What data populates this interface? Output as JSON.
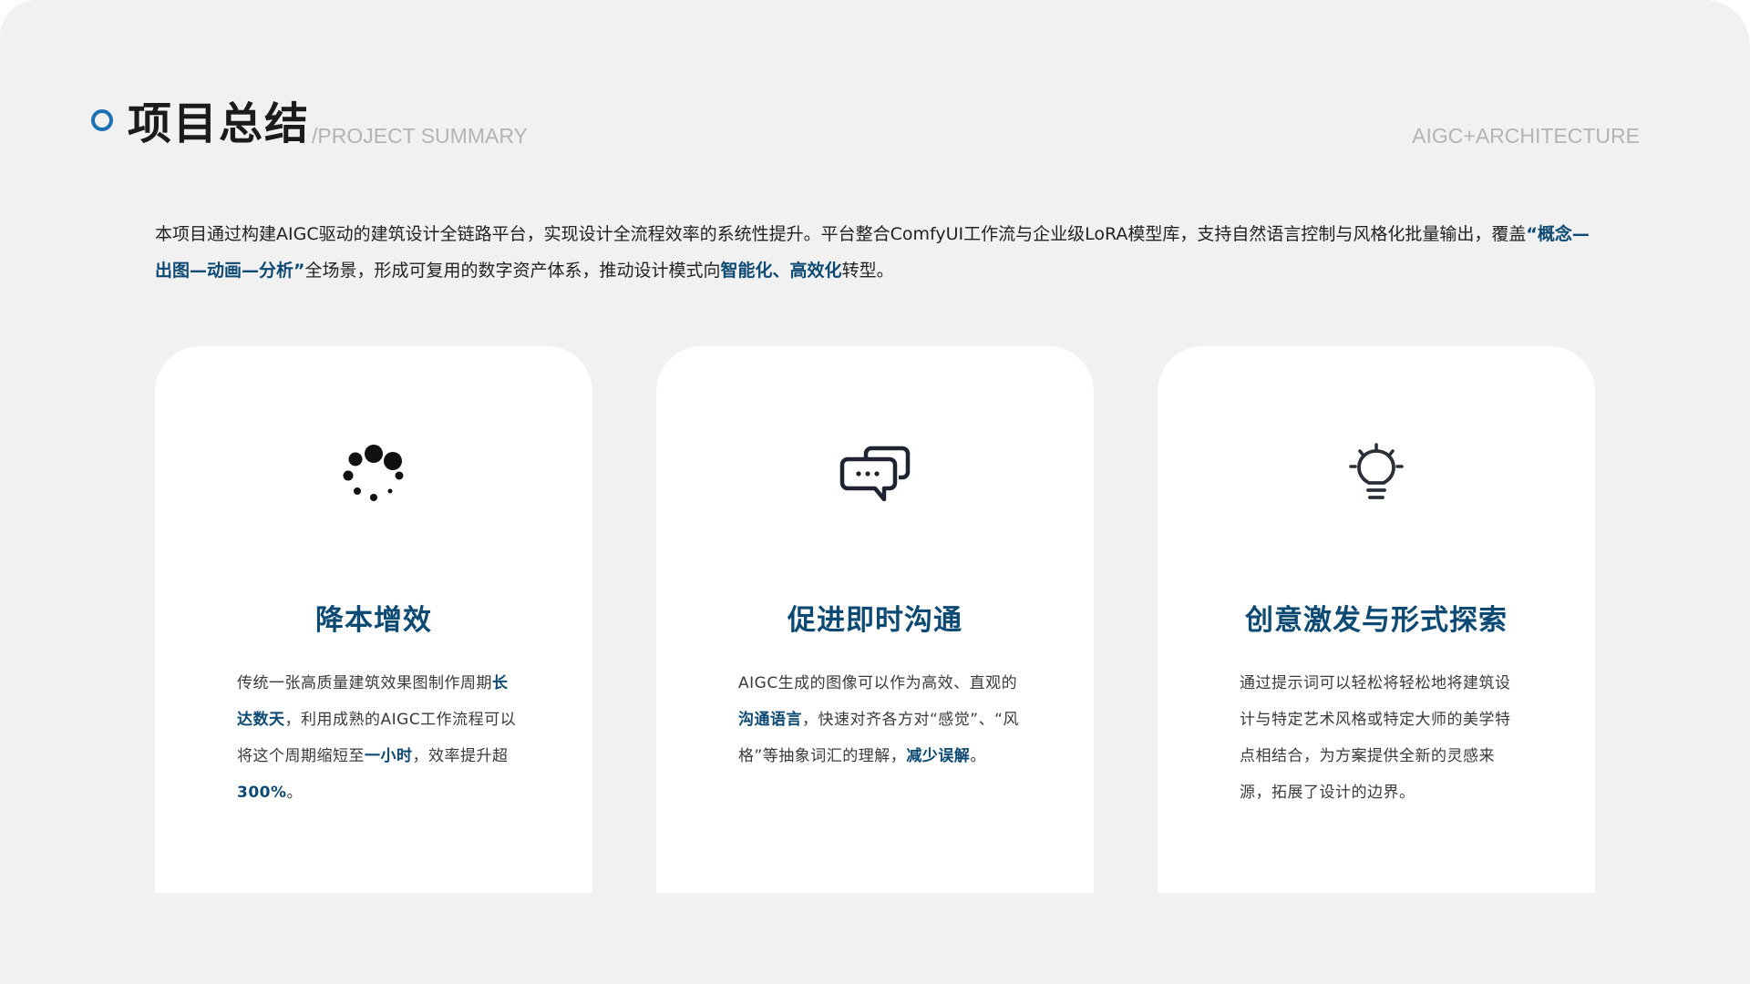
{
  "header": {
    "title": "项目总结",
    "subtitle": "/PROJECT SUMMARY",
    "tag": "AIGC+ARCHITECTURE"
  },
  "intro": {
    "part1": "本项目通过构建AIGC驱动的建筑设计全链路平台，实现设计全流程效率的系统性提升。平台整合ComfyUI工作流与企业级LoRA模型库，支持自然语言控制与风格化批量输出，覆盖",
    "highlight1": "“概念—出图—动画—分析”",
    "part2": "全场景，形成可复用的数字资产体系，推动设计模式向",
    "highlight2": "智能化",
    "sep": "、",
    "highlight3": "高效化",
    "part3": "转型。"
  },
  "cards": [
    {
      "icon": "loading-spinner-icon",
      "title": "降本增效",
      "text_1": "传统一张高质量建筑效果图制作周期",
      "hl_1": "长达数天",
      "text_2": "，利用成熟的AIGC工作流程可以将这个周期缩短至",
      "hl_2": "一小时",
      "text_3": "，效率提升超",
      "hl_3": "300%",
      "text_4": "。"
    },
    {
      "icon": "chat-bubbles-icon",
      "title": "促进即时沟通",
      "text_1": "AIGC生成的图像可以作为高效、直观的",
      "hl_1": "沟通语言",
      "text_2": "，快速对齐各方对“感觉”、“风格”等抽象词汇的理解，",
      "hl_2": "减少误解",
      "text_3": "。"
    },
    {
      "icon": "lightbulb-icon",
      "title": "创意激发与形式探索",
      "text_1": "通过提示词可以轻松将轻松地将建筑设计与特定艺术风格或特定大师的美学特点相结合，为方案提供全新的灵感来源，拓展了设计的边界。"
    }
  ],
  "colors": {
    "accent": "#0d4a73",
    "ring": "#1a72b0",
    "background": "#f1f1f1",
    "card": "#ffffff"
  }
}
